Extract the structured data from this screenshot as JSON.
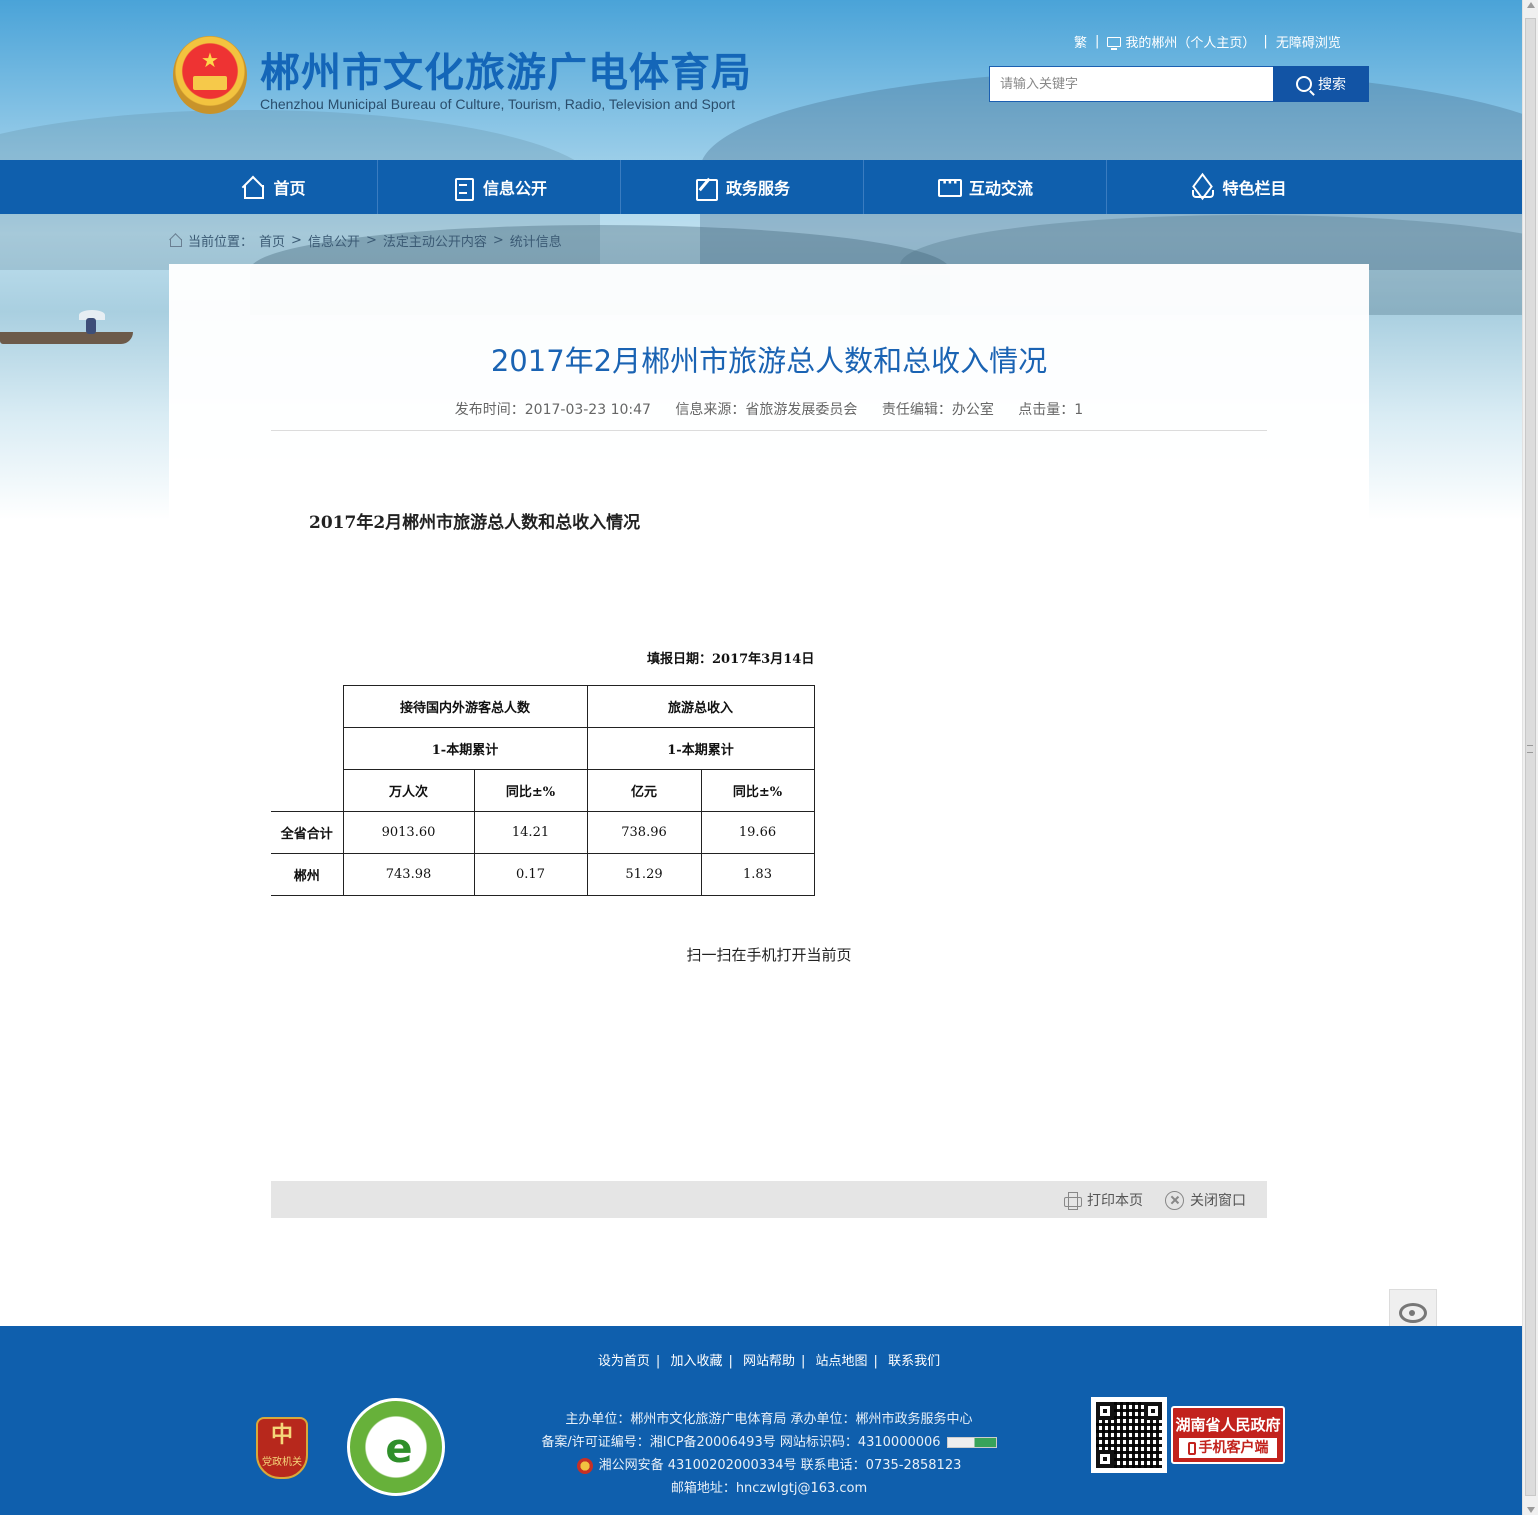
{
  "header": {
    "site_title": "郴州市文化旅游广电体育局",
    "site_subtitle": "Chenzhou Municipal Bureau of Culture, Tourism, Radio, Television and Sport",
    "top_links": {
      "traditional": "繁",
      "my_chenzhou": "我的郴州（个人主页）",
      "accessibility": "无障碍浏览"
    },
    "search": {
      "placeholder": "请输入关键字",
      "button_label": "搜索"
    }
  },
  "nav": {
    "items": [
      {
        "label": "首页",
        "icon": "home-icon"
      },
      {
        "label": "信息公开",
        "icon": "document-icon"
      },
      {
        "label": "政务服务",
        "icon": "edit-icon"
      },
      {
        "label": "互动交流",
        "icon": "chat-icon"
      },
      {
        "label": "特色栏目",
        "icon": "layers-icon"
      }
    ]
  },
  "breadcrumb": {
    "prefix": "当前位置：",
    "items": [
      "首页",
      "信息公开",
      "法定主动公开内容",
      "统计信息"
    ],
    "sep": ">"
  },
  "article": {
    "title": "2017年2月郴州市旅游总人数和总收入情况",
    "meta": {
      "publish_time": "发布时间：2017-03-23 10:47",
      "source": "信息来源：省旅游发展委员会",
      "editor": "责任编辑：办公室",
      "views": "点击量：1"
    },
    "body_heading": "2017年2月郴州市旅游总人数和总收入情况",
    "fill_date": "填报日期：2017年3月14日",
    "table": {
      "group_headers": [
        "接待国内外游客总人数",
        "旅游总收入"
      ],
      "period_headers": [
        "1-本期累计",
        "1-本期累计"
      ],
      "unit_headers": [
        "万人次",
        "同比±%",
        "亿元",
        "同比±%"
      ],
      "rows": [
        {
          "label": "全省合计",
          "values": [
            "9013.60",
            "14.21",
            "738.96",
            "19.66"
          ]
        },
        {
          "label": "郴州",
          "values": [
            "743.98",
            "0.17",
            "51.29",
            "1.83"
          ]
        }
      ]
    },
    "scan_text": "扫一扫在手机打开当前页",
    "actions": {
      "print": "打印本页",
      "close": "关闭窗口"
    }
  },
  "footer": {
    "links": [
      "设为首页",
      "加入收藏",
      "网站帮助",
      "站点地图",
      "联系我们"
    ],
    "sep": "|",
    "line1": "主办单位：郴州市文化旅游广电体育局   承办单位：郴州市政务服务中心",
    "line2": "备案/许可证编号：湘ICP备20006493号   网站标识码：4310000006",
    "line3": "湘公网安备 43100202000334号   联系电话：0735-2858123",
    "line4": "邮箱地址：hnczwlgtj@163.com",
    "party_badge": "党政机关",
    "app_badge_line1": "湖南省人民政府",
    "app_badge_line2": "手机客户端"
  }
}
